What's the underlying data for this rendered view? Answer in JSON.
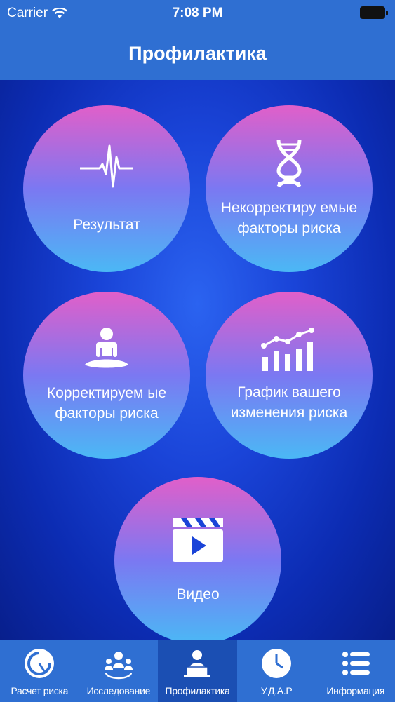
{
  "status": {
    "carrier": "Carrier",
    "time": "7:08 PM"
  },
  "nav": {
    "title": "Профилактика"
  },
  "tiles": [
    {
      "label": "Результат",
      "icon": "heartbeat-icon"
    },
    {
      "label": "Некорректиру емые факторы риска",
      "icon": "dna-icon"
    },
    {
      "label": "Корректируем ые факторы риска",
      "icon": "meditation-icon"
    },
    {
      "label": "График вашего изменения риска",
      "icon": "chart-icon"
    },
    {
      "label": "Видео",
      "icon": "video-icon"
    }
  ],
  "tabs": [
    {
      "label": "Расчет риска",
      "icon": "gauge-icon"
    },
    {
      "label": "Исследование",
      "icon": "people-icon"
    },
    {
      "label": "Профилактика",
      "icon": "person-laptop-icon",
      "active": true
    },
    {
      "label": "У.Д.А.Р",
      "icon": "clock-icon"
    },
    {
      "label": "Информация",
      "icon": "list-icon"
    }
  ],
  "colors": {
    "bar": "#2f6fd2",
    "active_tab": "#1b4fb3",
    "background": "#1a44d8"
  }
}
